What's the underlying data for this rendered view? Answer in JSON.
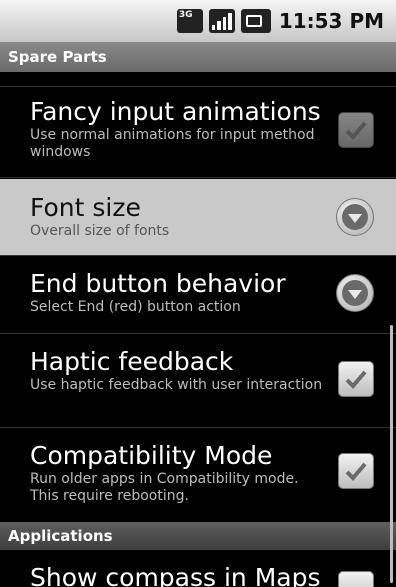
{
  "status_bar": {
    "network_label": "3G",
    "time": "11:53 PM",
    "icons": [
      "3g-data-icon",
      "signal-strength-icon",
      "battery-icon"
    ]
  },
  "title_bar": {
    "title": "Spare Parts"
  },
  "preferences": [
    {
      "title": "Fancy input animations",
      "summary": "Use normal animations for input method windows",
      "widget": "checkbox",
      "checked": true,
      "enabled": false
    },
    {
      "title": "Font size",
      "summary": "Overall size of fonts",
      "widget": "dropdown",
      "highlighted": true
    },
    {
      "title": "End button behavior",
      "summary": "Select End (red) button action",
      "widget": "dropdown"
    },
    {
      "title": "Haptic feedback",
      "summary": "Use haptic feedback with user interaction",
      "widget": "checkbox",
      "checked": true,
      "enabled": true
    },
    {
      "title": "Compatibility Mode",
      "summary": "Run older apps in Compatibility mode. This require rebooting.",
      "widget": "checkbox",
      "checked": true,
      "enabled": true
    }
  ],
  "section_header": {
    "label": "Applications"
  },
  "partial_item": {
    "title": "Show compass in Maps"
  },
  "colors": {
    "background": "#000000",
    "highlight": "#c9c9c9",
    "summary_text": "#bdbdbd"
  }
}
